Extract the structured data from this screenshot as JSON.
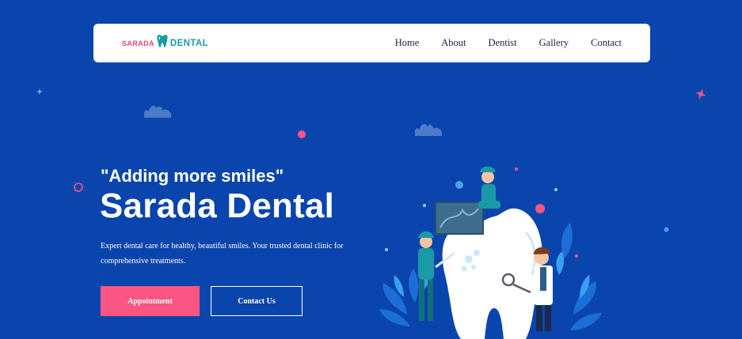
{
  "brand": {
    "part1": "SARADA",
    "part2": "DENTAL"
  },
  "nav": {
    "items": [
      {
        "label": "Home"
      },
      {
        "label": "About"
      },
      {
        "label": "Dentist"
      },
      {
        "label": "Gallery"
      },
      {
        "label": "Contact"
      }
    ]
  },
  "hero": {
    "tagline": "\"Adding more smiles\"",
    "title": "Sarada Dental",
    "description": "Expert dental care for healthy, beautiful smiles. Your trusted dental clinic for comprehensive treatments.",
    "primary_button": "Appointment",
    "secondary_button": "Contact Us"
  },
  "colors": {
    "background": "#0a45ad",
    "accent_pink": "#fb5585",
    "brand_teal": "#1a9aa7",
    "nav_text": "#1a1f4b"
  },
  "icons": [
    "tooth-logo-icon",
    "cloud-icon",
    "sparkle-icon",
    "circle-outline-icon",
    "dot-icon"
  ]
}
